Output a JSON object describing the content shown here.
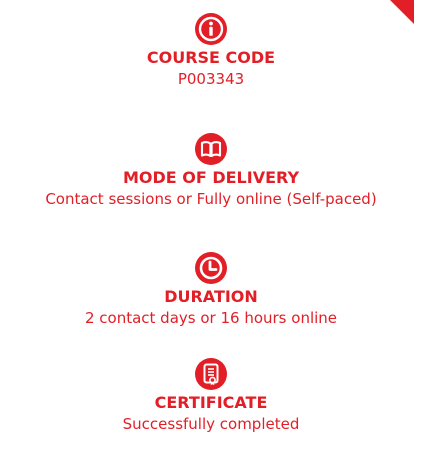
{
  "accent_color": "#e21e26",
  "items": [
    {
      "icon": "info-icon",
      "label": "COURSE CODE",
      "value": "P003343"
    },
    {
      "icon": "book-icon",
      "label": "MODE OF DELIVERY",
      "value": "Contact sessions or Fully online (Self-paced)"
    },
    {
      "icon": "clock-icon",
      "label": "DURATION",
      "value": "2 contact days or 16 hours online"
    },
    {
      "icon": "certificate-icon",
      "label": "CERTIFICATE",
      "value": "Successfully completed"
    }
  ]
}
